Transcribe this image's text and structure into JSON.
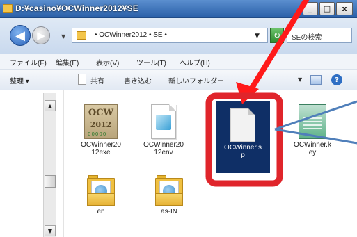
{
  "window": {
    "title": "D:¥casino¥OCWinner2012¥SE",
    "buttons": {
      "minimize": "_",
      "maximize": "□",
      "close": "x"
    }
  },
  "address": {
    "path_text": "• OCWinner2012 • SE •",
    "search_placeholder": "SEの検索"
  },
  "menubar": {
    "items": [
      "ファイル(F)",
      "編集(E)",
      "表示(V)",
      "ツール(T)",
      "ヘルプ(H)"
    ]
  },
  "toolbar": {
    "organize": "整理 ▾",
    "share": "共有",
    "burn": "書き込む",
    "new_folder": "新しいフォルダー"
  },
  "files": [
    {
      "name": "OCWinner2012exe",
      "label_line1": "OCWinner20",
      "label_line2": "12exe",
      "icon": "ocw-app-icon",
      "icon_text1": "OCW",
      "icon_text2": "2012",
      "icon_text3": "00000"
    },
    {
      "name": "OCWinner2012env",
      "label_line1": "OCWinner20",
      "label_line2": "12env",
      "icon": "image-file-icon"
    },
    {
      "name": "OCWinner.sp",
      "label_line1": "OCWinner.s",
      "label_line2": "p",
      "icon": "blank-file-icon",
      "selected": true
    },
    {
      "name": "OCWinner.key",
      "label_line1": "OCWinner.k",
      "label_line2": "ey",
      "icon": "key-file-icon"
    },
    {
      "name": "en",
      "label_line1": "en",
      "icon": "folder-icon"
    },
    {
      "name": "as-IN",
      "label_line1": "as-IN",
      "icon": "folder-icon"
    }
  ],
  "annotations": {
    "arrow_color": "#ff1a1a",
    "highlight_color": "#e0252b",
    "callout_color": "#4f7fba"
  }
}
